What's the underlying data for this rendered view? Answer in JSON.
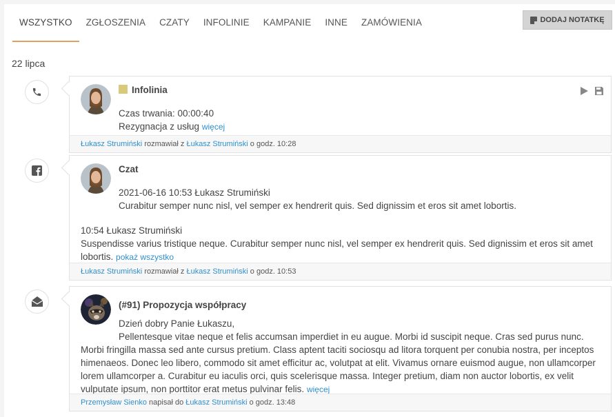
{
  "tabs": [
    {
      "label": "WSZYSTKO"
    },
    {
      "label": "ZGŁOSZENIA"
    },
    {
      "label": "CZATY"
    },
    {
      "label": "INFOLINIE"
    },
    {
      "label": "KAMPANIE"
    },
    {
      "label": "INNE"
    },
    {
      "label": "ZAMÓWIENIA"
    }
  ],
  "add_note_label": "DODAJ NOTATKĘ",
  "date_label": "22 lipca",
  "call": {
    "icon": "phone-icon",
    "title": "Infolinia",
    "duration": "Czas trwania: 00:00:40",
    "reason": "Rezygnacja z usług",
    "more": "więcej",
    "footer": {
      "user1": "Łukasz Strumiński",
      "verb": "rozmawiał z",
      "user2": "Łukasz Strumiński",
      "time": "o godz. 10:28"
    }
  },
  "chat": {
    "icon": "facebook-icon",
    "title": "Czat",
    "msg1_header": "2021-06-16 10:53 Łukasz Strumiński",
    "msg1_text": "Curabitur semper nunc nisl, vel semper ex hendrerit quis. Sed dignissim et eros sit amet lobortis.",
    "msg2_header": "10:54 Łukasz Strumiński",
    "msg2_text": "Suspendisse varius tristique neque. Curabitur semper nunc nisl, vel semper ex hendrerit quis. Sed dignissim et eros sit amet lobortis.",
    "show_all": "pokaż wszystko",
    "footer": {
      "user1": "Łukasz Strumiński",
      "verb": "rozmawiał z",
      "user2": "Łukasz Strumiński",
      "time": "o godz. 10:53"
    }
  },
  "email": {
    "icon": "envelope-open-icon",
    "title": "(#91) Propozycja współpracy",
    "greeting": "Dzień dobry Panie Łukaszu,",
    "text_first": "Pellentesque vitae neque et felis accumsan imperdiet in eu augue. Morbi id suscipit neque. Cras sed purus nunc.",
    "text_rest": "Morbi fringilla massa sed ante cursus pretium. Class aptent taciti sociosqu ad litora torquent per conubia nostra, per inceptos himenaeos. Donec leo libero, commodo sit amet efficitur ac, volutpat at elit. Vivamus ornare euismod augue, non ullamcorper lorem ullamcorper a. Curabitur eu iaculis orci, quis scelerisque massa. Integer pretium, diam non auctor lobortis, ex velit vulputate ipsum, non porttitor erat metus pulvinar felis.",
    "more": "więcej",
    "footer": {
      "user1": "Przemysław Sienko",
      "verb": "napisał do",
      "user2": "Łukasz Strumiński",
      "time": "o godz. 13:48"
    }
  },
  "colors": {
    "accent": "#2e8fcf",
    "tab_underline": "#e0a060",
    "infolinia_badge": "#d9c97a"
  }
}
